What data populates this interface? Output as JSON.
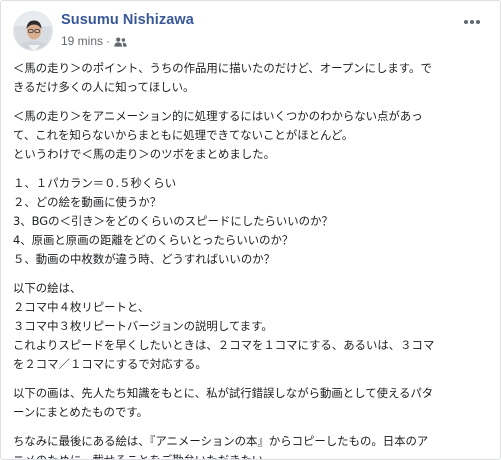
{
  "post": {
    "author": "Susumu Nishizawa",
    "time": "19 mins",
    "separator": "·",
    "audience_icon": "friends-icon",
    "more_icon": "ellipsis-icon"
  },
  "body": {
    "p1": [
      "＜馬の走り＞のポイント、うちの作品用に描いたのだけど、オープンにします。で",
      "きるだけ多くの人に知ってほしい。"
    ],
    "p2": [
      "＜馬の走り＞をアニメーション的に処理するにはいくつかのわからない点があっ",
      "て、これを知らないからまともに処理できてないことがほとんど。",
      "というわけで＜馬の走り＞のツボをまとめました。"
    ],
    "p3": [
      "１、１パカラン＝０.５秒くらい",
      "２、どの絵を動画に使うか？",
      "3、BGの＜引き＞をどのくらいのスピードにしたらいいのか？",
      "4、原画と原画の距離をどのくらいとったらいいのか？",
      "５、動画の中枚数が違う時、どうすればいいのか？"
    ],
    "p4": [
      "以下の絵は、",
      "２コマ中４枚リピートと、",
      "３コマ中３枚リピートバージョンの説明してます。",
      "これよりスピードを早くしたいときは、２コマを１コマにする、あるいは、３コマ",
      "を２コマ／１コマにするで対応する。"
    ],
    "p5": [
      "以下の画は、先人たち知識をもとに、私が試行錯誤しながら動画として使えるパタ",
      "ーンにまとめたものです。"
    ],
    "p6": [
      "ちなみに最後にある絵は、『アニメーションの本』からコピーしたもの。日本のア",
      "ニメのために、載せることをご勘弁いただきたい。"
    ]
  },
  "colors": {
    "author": "#385898",
    "meta": "#616770",
    "text": "#1c1e21",
    "border": "#dddfe2"
  }
}
